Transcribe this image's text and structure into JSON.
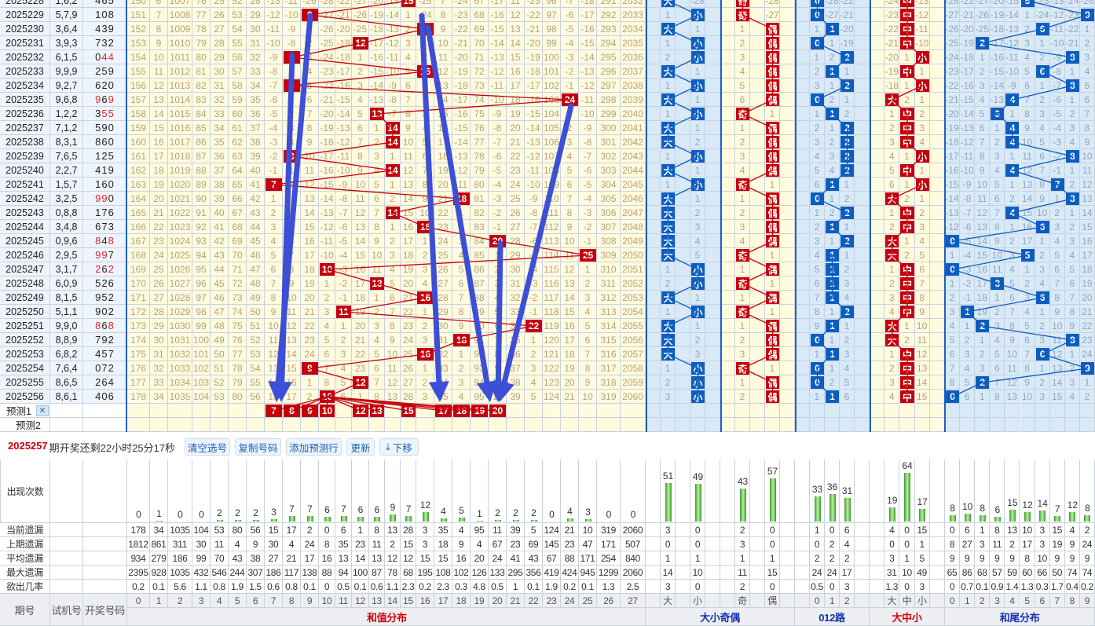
{
  "info": {
    "next_issue": "2025257",
    "countdown": "期开奖还剩22小时25分17秒"
  },
  "buttons": {
    "clear": "清空选号",
    "copy": "复制号码",
    "add_row": "添加预测行",
    "update": "更新",
    "move_down": "下移"
  },
  "headers": {
    "issue": "期号",
    "trial": "试机号",
    "draw": "开奖号码"
  },
  "section_titles": {
    "sum": "和值分布",
    "bsoe": "大小奇偶",
    "road": "012路",
    "bms": "大中小",
    "tail": "和尾分布"
  },
  "rows": [
    {
      "issue": "2025228",
      "trial": "1,6,2",
      "draw": "4 6 5",
      "sum": 15
    },
    {
      "issue": "2025229",
      "trial": "5,7,9",
      "draw": "1 0 8",
      "sum": 9
    },
    {
      "issue": "2025230",
      "trial": "3,6,4",
      "draw": "4 3 9",
      "sum": 16
    },
    {
      "issue": "2025231",
      "trial": "3,9,3",
      "draw": "7 3 2",
      "sum": 12
    },
    {
      "issue": "2025232",
      "trial": "6,1,5",
      "draw": "0 4 4",
      "sum": 8
    },
    {
      "issue": "2025233",
      "trial": "9,9,9",
      "draw": "2 5 9",
      "sum": 16
    },
    {
      "issue": "2025234",
      "trial": "9,2,7",
      "draw": "6 2 0",
      "sum": 8
    },
    {
      "issue": "2025235",
      "trial": "9,6,8",
      "draw": "9 6 9",
      "sum": 24
    },
    {
      "issue": "2025236",
      "trial": "1,2,2",
      "draw": "3 5 5",
      "sum": 13
    },
    {
      "issue": "2025237",
      "trial": "7,1,2",
      "draw": "5 9 0",
      "sum": 14
    },
    {
      "issue": "2025238",
      "trial": "8,3,1",
      "draw": "8 6 0",
      "sum": 14
    },
    {
      "issue": "2025239",
      "trial": "7,6,5",
      "draw": "1 2 5",
      "sum": 8
    },
    {
      "issue": "2025240",
      "trial": "2,2,7",
      "draw": "4 1 9",
      "sum": 14
    },
    {
      "issue": "2025241",
      "trial": "1,5,7",
      "draw": "1 6 0",
      "sum": 7
    },
    {
      "issue": "2025242",
      "trial": "3,2,5",
      "draw": "9 9 0",
      "sum": 18
    },
    {
      "issue": "2025243",
      "trial": "0,8,8",
      "draw": "1 7 6",
      "sum": 14
    },
    {
      "issue": "2025244",
      "trial": "3,4,8",
      "draw": "6 7 3",
      "sum": 16
    },
    {
      "issue": "2025245",
      "trial": "0,9,6",
      "draw": "8 4 8",
      "sum": 20
    },
    {
      "issue": "2025246",
      "trial": "2,9,5",
      "draw": "9 9 7",
      "sum": 25
    },
    {
      "issue": "2025247",
      "trial": "3,1,7",
      "draw": "2 6 2",
      "sum": 10
    },
    {
      "issue": "2025248",
      "trial": "6,0,9",
      "draw": "5 2 6",
      "sum": 13
    },
    {
      "issue": "2025249",
      "trial": "8,1,5",
      "draw": "9 5 2",
      "sum": 16
    },
    {
      "issue": "2025250",
      "trial": "5,1,1",
      "draw": "9 0 2",
      "sum": 11
    },
    {
      "issue": "2025251",
      "trial": "9,9,0",
      "draw": "8 6 8",
      "sum": 22
    },
    {
      "issue": "2025252",
      "trial": "8,8,9",
      "draw": "7 9 2",
      "sum": 18
    },
    {
      "issue": "2025253",
      "trial": "6,8,2",
      "draw": "4 5 7",
      "sum": 16
    },
    {
      "issue": "2025254",
      "trial": "7,6,4",
      "draw": "0 7 2",
      "sum": 9
    },
    {
      "issue": "2025255",
      "trial": "8,6,5",
      "draw": "2 6 4",
      "sum": 12
    },
    {
      "issue": "2025256",
      "trial": "8,6,1",
      "draw": "4 0 6",
      "sum": 10
    }
  ],
  "predict": {
    "row1_label": "预测1",
    "row2_label": "预测2",
    "row1_values": [
      "7",
      "8",
      "9",
      "10",
      "12",
      "13",
      "15",
      "17",
      "18",
      "19",
      "20"
    ]
  },
  "stat_labels": {
    "count": "出现次数",
    "current": "当前遗漏",
    "prev": "上期遗漏",
    "avg": "平均遗漏",
    "max": "最大遗漏",
    "rate": "欲出几率"
  },
  "stats": {
    "sum": {
      "ticks": [
        "0",
        "1",
        "2",
        "3",
        "4",
        "5",
        "6",
        "7",
        "8",
        "9",
        "10",
        "11",
        "12",
        "13",
        "14",
        "15",
        "16",
        "17",
        "18",
        "19",
        "20",
        "21",
        "22",
        "23",
        "24",
        "25",
        "26",
        "27"
      ],
      "count": [
        "0",
        "1",
        "0",
        "0",
        "2",
        "2",
        "2",
        "3",
        "7",
        "7",
        "6",
        "7",
        "6",
        "6",
        "9",
        "7",
        "12",
        "4",
        "5",
        "1",
        "2",
        "2",
        "2",
        "0",
        "4",
        "3",
        "0",
        "0"
      ],
      "current": [
        "178",
        "34",
        "1035",
        "104",
        "53",
        "80",
        "56",
        "15",
        "17",
        "2",
        "0",
        "6",
        "1",
        "8",
        "13",
        "28",
        "3",
        "35",
        "4",
        "95",
        "11",
        "39",
        "5",
        "124",
        "21",
        "10",
        "319",
        "2060"
      ],
      "prev": [
        "1812",
        "861",
        "311",
        "30",
        "11",
        "4",
        "9",
        "30",
        "4",
        "24",
        "8",
        "35",
        "23",
        "11",
        "2",
        "15",
        "3",
        "18",
        "9",
        "4",
        "67",
        "23",
        "69",
        "145",
        "23",
        "47",
        "171",
        "507"
      ],
      "avg": [
        "934",
        "279",
        "186",
        "99",
        "70",
        "43",
        "38",
        "27",
        "21",
        "17",
        "16",
        "13",
        "14",
        "13",
        "12",
        "12",
        "15",
        "15",
        "16",
        "20",
        "24",
        "41",
        "43",
        "67",
        "88",
        "171",
        "254",
        "840"
      ],
      "max": [
        "2395",
        "928",
        "1035",
        "432",
        "546",
        "244",
        "307",
        "186",
        "117",
        "138",
        "88",
        "94",
        "100",
        "87",
        "78",
        "68",
        "195",
        "108",
        "102",
        "126",
        "133",
        "295",
        "356",
        "419",
        "424",
        "945",
        "1299",
        "2060"
      ],
      "rate": [
        "0.2",
        "0.1",
        "5.6",
        "1.1",
        "0.8",
        "1.9",
        "1.5",
        "0.6",
        "0.8",
        "0.1",
        "0",
        "0.5",
        "0.1",
        "0.6",
        "1.1",
        "2.3",
        "0.2",
        "2.3",
        "0.3",
        "4.8",
        "0.5",
        "1",
        "0.1",
        "1.9",
        "0.2",
        "0.1",
        "1.3",
        "2.5"
      ]
    },
    "bs": {
      "ticks": [
        "大",
        "小"
      ],
      "count": [
        "51",
        "49"
      ],
      "current": [
        "3",
        "0"
      ],
      "prev": [
        "0",
        "0"
      ],
      "avg": [
        "1",
        "1"
      ],
      "max": [
        "14",
        "10"
      ],
      "rate": [
        "3",
        "0"
      ]
    },
    "oe": {
      "ticks": [
        "奇",
        "偶"
      ],
      "count": [
        "43",
        "57"
      ],
      "current": [
        "2",
        "0"
      ],
      "prev": [
        "3",
        "0"
      ],
      "avg": [
        "1",
        "1"
      ],
      "max": [
        "11",
        "15"
      ],
      "rate": [
        "2",
        "0"
      ]
    },
    "road": {
      "ticks": [
        "0",
        "1",
        "2"
      ],
      "count": [
        "33",
        "36",
        "31"
      ],
      "current": [
        "1",
        "0",
        "6"
      ],
      "prev": [
        "0",
        "2",
        "4"
      ],
      "avg": [
        "2",
        "2",
        "2"
      ],
      "max": [
        "24",
        "24",
        "17"
      ],
      "rate": [
        "0.5",
        "0",
        "3"
      ]
    },
    "bms": {
      "ticks": [
        "大",
        "中",
        "小"
      ],
      "count": [
        "19",
        "64",
        "17"
      ],
      "current": [
        "4",
        "0",
        "15"
      ],
      "prev": [
        "0",
        "0",
        "1"
      ],
      "avg": [
        "3",
        "1",
        "5"
      ],
      "max": [
        "31",
        "10",
        "49"
      ],
      "rate": [
        "1.3",
        "0",
        "3"
      ]
    },
    "tail": {
      "ticks": [
        "0",
        "1",
        "2",
        "3",
        "4",
        "5",
        "6",
        "7",
        "8",
        "9"
      ],
      "count": [
        "8",
        "10",
        "8",
        "6",
        "15",
        "12",
        "14",
        "7",
        "12",
        "8"
      ],
      "current": [
        "0",
        "6",
        "1",
        "8",
        "13",
        "10",
        "3",
        "15",
        "4",
        "2"
      ],
      "prev": [
        "8",
        "27",
        "3",
        "11",
        "2",
        "17",
        "3",
        "19",
        "9",
        "24"
      ],
      "avg": [
        "9",
        "9",
        "9",
        "9",
        "9",
        "8",
        "10",
        "9",
        "9",
        "9"
      ],
      "max": [
        "65",
        "86",
        "68",
        "57",
        "59",
        "60",
        "66",
        "50",
        "74",
        "74"
      ],
      "rate": [
        "0",
        "0.7",
        "0.1",
        "0.9",
        "1.4",
        "1.3",
        "0.3",
        "1.7",
        "0.4",
        "0.2"
      ]
    }
  },
  "colors": {
    "red": "#c6000b",
    "blue": "#0c5dc0",
    "arrow": "#3d4fd6"
  }
}
